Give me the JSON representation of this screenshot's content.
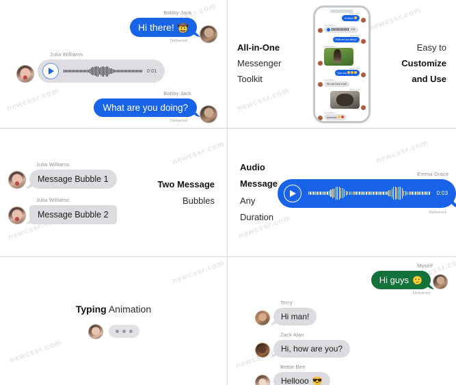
{
  "watermark": {
    "text": "newcssr.com"
  },
  "colors": {
    "blue": "#1863e8",
    "grey_bubble": "#dcdce0",
    "green": "#12723a",
    "divider": "#d8d8d8",
    "sender_label": "#8d8d8d"
  },
  "panel_top_left": {
    "name": "imessage-blue-conversation",
    "messages": [
      {
        "sender": "Bobby Jack",
        "text": "Hi there!",
        "emoji": "🤠",
        "status": "Delivered",
        "side": "right",
        "style": "blue"
      },
      {
        "sender": "Julia Williams",
        "type": "audio",
        "duration": "0:01",
        "side": "left",
        "style": "grey"
      },
      {
        "sender": "Bobby Jack",
        "text": "What are you doing?",
        "status": "Delivered",
        "side": "right",
        "style": "blue"
      }
    ]
  },
  "panel_top_right": {
    "name": "phone-showcase",
    "left_text": {
      "line1": "All-in-One",
      "line2": "Messenger",
      "line3": "Toolkit"
    },
    "right_text": {
      "line1": "Easy to",
      "line2": "Customize",
      "line3": "and Use"
    },
    "phone_preview": {
      "messages": [
        {
          "sender": "Bobby Jack",
          "text": "Hi there!",
          "status": "Delivered",
          "side": "right",
          "style": "blue"
        },
        {
          "sender": "Julia Williams",
          "type": "audio",
          "duration": "0:01",
          "side": "left",
          "style": "grey"
        },
        {
          "sender": "Bobby Jack",
          "text": "What are you doing?",
          "status": "Delivered",
          "side": "right",
          "style": "blue"
        },
        {
          "sender": "Julia Williams",
          "type": "image",
          "image": "woman-on-grass-photo",
          "side": "left"
        },
        {
          "sender": "Bobby Jack",
          "text": "Nice one",
          "type": "emoji-row",
          "status": "Delivered",
          "side": "right",
          "style": "blue"
        },
        {
          "sender": "Julia Williams",
          "text": "We can have a ball",
          "side": "left",
          "style": "grey"
        },
        {
          "sender": "Bobby Jack",
          "type": "image",
          "image": "black-dog-photo",
          "status": "Delivered",
          "side": "right"
        },
        {
          "sender": "Julia Williams",
          "text": "Awesome",
          "type": "emoji-row",
          "side": "left",
          "style": "grey"
        }
      ]
    }
  },
  "panel_mid_left": {
    "name": "two-message-bubbles",
    "caption": {
      "bold": "Two Message",
      "normal": "Bubbles"
    },
    "bubbles": [
      {
        "sender": "Julia Williams",
        "text": "Message Bubble 1",
        "shape": "rounded"
      },
      {
        "sender": "Julia Williams",
        "text": "Message Bubble 2",
        "shape": "square"
      }
    ]
  },
  "panel_mid_right": {
    "name": "audio-message",
    "caption": {
      "bold": "Audio Message",
      "normal": "Any Duration"
    },
    "message": {
      "sender": "Emma Grace",
      "duration": "0:03",
      "status": "Delivered"
    }
  },
  "panel_bot_left": {
    "name": "typing-animation",
    "caption": {
      "bold": "Typing",
      "normal": "Animation"
    },
    "dots": 3
  },
  "panel_bot_right": {
    "name": "group-conversation",
    "outgoing": {
      "sender": "Myself",
      "text": "Hi guys",
      "emoji": "🙂",
      "status": "Delivered"
    },
    "incoming": [
      {
        "sender": "Terry",
        "text": "Hi man!"
      },
      {
        "sender": "Zack Alan",
        "text": "Hi, how are you?"
      },
      {
        "sender": "Bettie Bee",
        "text": "Hellooo",
        "emoji": "😎"
      }
    ]
  }
}
